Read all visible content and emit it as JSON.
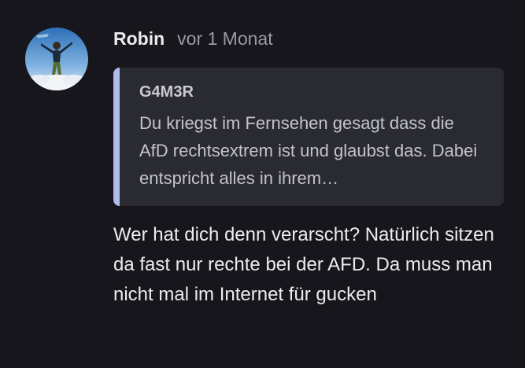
{
  "comment": {
    "author": "Robin",
    "timestamp": "vor 1 Monat",
    "avatar_icon": "user-avatar-icon",
    "quote": {
      "author": "G4M3R",
      "text": "Du kriegst im Fernsehen gesagt dass die AfD rechtsextrem ist und glaubst das. Dabei entspricht alles in ihrem…",
      "accent_color": "#aebcf0"
    },
    "body": "Wer hat dich denn verarscht? Natürlich sitzen da fast nur rechte bei der AFD. Da muss man nicht mal im Internet für gucken"
  },
  "colors": {
    "background": "#16161c",
    "quote_background": "#2a2b31",
    "text_primary": "#ececf0",
    "text_muted": "#9a9aa6"
  }
}
